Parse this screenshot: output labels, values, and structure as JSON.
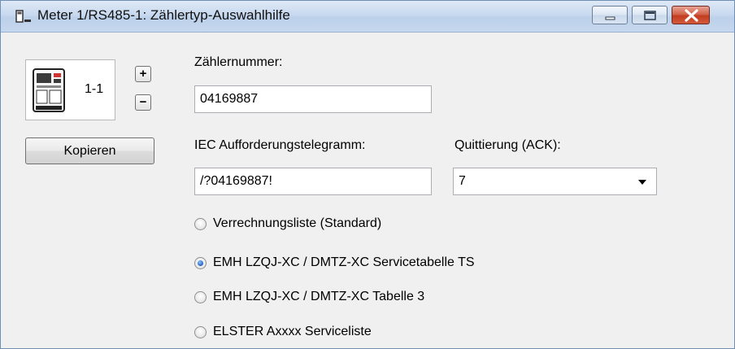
{
  "window": {
    "title": "Meter 1/RS485-1: Zählertyp-Auswahlhilfe",
    "controls": [
      "minimize",
      "maximize",
      "close"
    ]
  },
  "meter": {
    "tile_label": "1-1",
    "plus_label": "+",
    "minus_label": "−",
    "copy_button": "Kopieren"
  },
  "form": {
    "meter_number_label": "Zählernummer:",
    "meter_number_value": "04169887",
    "iec_request_label": "IEC Aufforderungstelegramm:",
    "iec_request_value": "/?04169887!",
    "ack_label": "Quittierung (ACK):",
    "ack_value": "7"
  },
  "options": [
    {
      "label": "Verrechnungsliste (Standard)",
      "checked": false
    },
    {
      "label": "EMH LZQJ-XC / DMTZ-XC Servicetabelle TS",
      "checked": true
    },
    {
      "label": "EMH LZQJ-XC / DMTZ-XC Tabelle 3",
      "checked": false
    },
    {
      "label": "ELSTER Axxxx Serviceliste",
      "checked": false
    }
  ],
  "colors": {
    "titlebar": "#c8d9ef",
    "close_button": "#c23d20",
    "radio_selected": "#1f5fbf"
  }
}
